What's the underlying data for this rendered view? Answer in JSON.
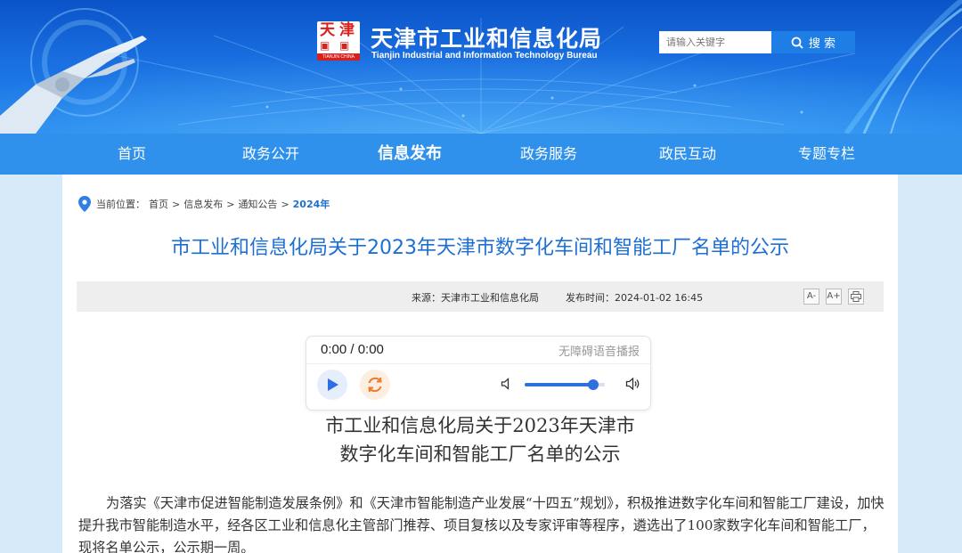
{
  "header": {
    "site_title": "天津市工业和信息化局",
    "site_subtitle": "Tianjin Industrial and Information Technology Bureau",
    "logo": {
      "chars": [
        "天",
        "津"
      ],
      "strip_text": "TIANJIN CHINA"
    },
    "search": {
      "placeholder": "请输入关键字",
      "button_label": "搜 索"
    }
  },
  "nav": {
    "items": [
      {
        "label": "首页"
      },
      {
        "label": "政务公开"
      },
      {
        "label": "信息发布",
        "active": true
      },
      {
        "label": "政务服务"
      },
      {
        "label": "政民互动"
      },
      {
        "label": "专题专栏"
      }
    ]
  },
  "breadcrumb": {
    "prefix": "当前位置：",
    "items": [
      "首页",
      "信息发布",
      "通知公告"
    ],
    "separator": ">",
    "current": "2024年"
  },
  "article": {
    "title": "市工业和信息化局关于2023年天津市数字化车间和智能工厂名单的公示",
    "meta": {
      "source_label": "来源：",
      "source": "天津市工业和信息化局",
      "date_label": "发布时间：",
      "date": "2024-01-02 16:45"
    },
    "tools": {
      "font_decrease": "A-",
      "font_increase": "A+",
      "print_icon": "print-icon"
    },
    "doc_title_lines": [
      "市工业和信息化局关于2023年天津市",
      "数字化车间和智能工厂名单的公示"
    ],
    "paragraph": "为落实《天津市促进智能制造发展条例》和《天津市智能制造产业发展“十四五”规划》，积极推进数字化车间和智能工厂建设，加快提升我市智能制造水平，经各区工业和信息化主管部门推荐、项目复核以及专家评审等程序，遴选出了100家数字化车间和智能工厂，现将名单公示，公示期一周。"
  },
  "player": {
    "time": "0:00 / 0:00",
    "label": "无障碍语音播报",
    "volume": 0.85,
    "colors": {
      "accent": "#2f6fe0",
      "loop": "#f07a2a"
    }
  },
  "colors": {
    "header_blue": "#0a53c9",
    "nav_blue": "#2f91ec",
    "title_blue": "#1d6fd3",
    "page_bg": "#d7eaf9"
  }
}
